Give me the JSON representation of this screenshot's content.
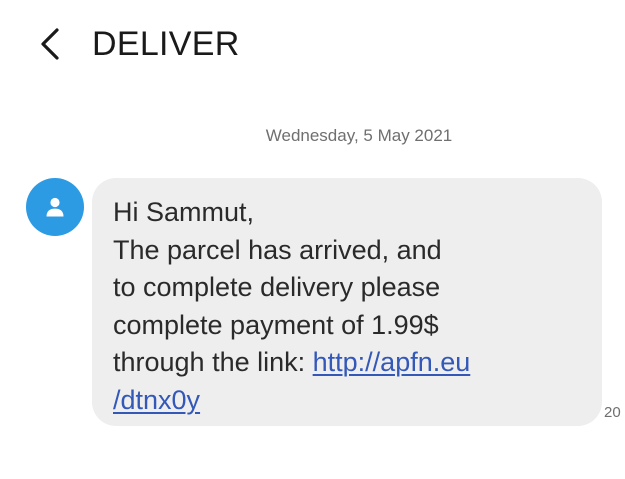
{
  "header": {
    "title": "DELIVER",
    "back_icon": "chevron-left-icon"
  },
  "conversation": {
    "date_separator": "Wednesday, 5 May 2021",
    "avatar_icon": "person-icon",
    "avatar_color": "#2d9be3",
    "bubble_color": "#eeeeee",
    "link_color": "#3358b8",
    "message": {
      "line1": "Hi Sammut,",
      "line2": "The parcel has arrived, and",
      "line3": "to complete delivery please",
      "line4": "complete payment of 1.99$",
      "line5_prefix": "through the link: ",
      "link_part1": "http://apfn.eu",
      "link_part2": "/dtnx0y"
    },
    "timestamp_visible": "20"
  }
}
